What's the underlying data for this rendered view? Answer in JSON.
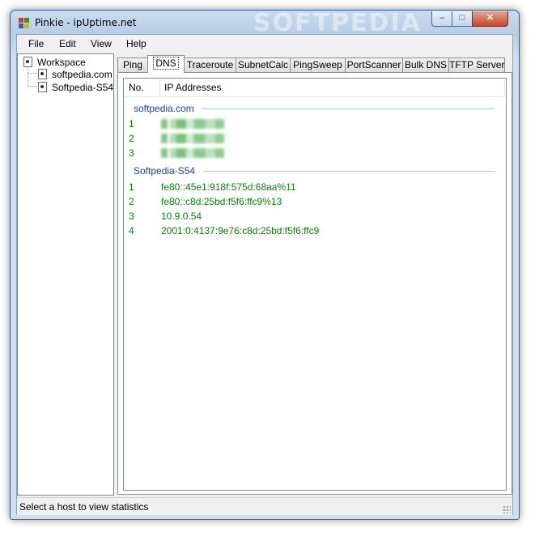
{
  "window": {
    "title": "Pinkie - ipUptime.net",
    "watermark": "SOFTPEDIA",
    "controls": {
      "minimize": "–",
      "maximize": "□",
      "close": "✕"
    }
  },
  "menu": [
    "File",
    "Edit",
    "View",
    "Help"
  ],
  "tree": {
    "root": "Workspace",
    "children": [
      "softpedia.com",
      "Softpedia-S54"
    ]
  },
  "tabs": [
    "Ping",
    "DNS",
    "Traceroute",
    "SubnetCalc",
    "PingSweep",
    "PortScanner",
    "Bulk DNS",
    "TFTP Server"
  ],
  "active_tab": "DNS",
  "list": {
    "columns": [
      "No.",
      "IP Addresses"
    ],
    "groups": [
      {
        "name": "softpedia.com",
        "rows": [
          {
            "no": "1",
            "ip": ""
          },
          {
            "no": "2",
            "ip": ""
          },
          {
            "no": "3",
            "ip": ""
          }
        ]
      },
      {
        "name": "Softpedia-S54",
        "rows": [
          {
            "no": "1",
            "ip": "fe80::45e1:918f:575d:68aa%11"
          },
          {
            "no": "2",
            "ip": "fe80::c8d:25bd:f5f6:ffc9%13"
          },
          {
            "no": "3",
            "ip": "10.9.0.54"
          },
          {
            "no": "4",
            "ip": "2001:0:4137:9e76:c8d:25bd:f5f6:ffc9"
          }
        ]
      }
    ]
  },
  "status": "Select a host to view statistics",
  "colors": {
    "group_header": "#1e3f97",
    "row_text": "#0a7d0a",
    "title_bar": "#b7cde6"
  }
}
